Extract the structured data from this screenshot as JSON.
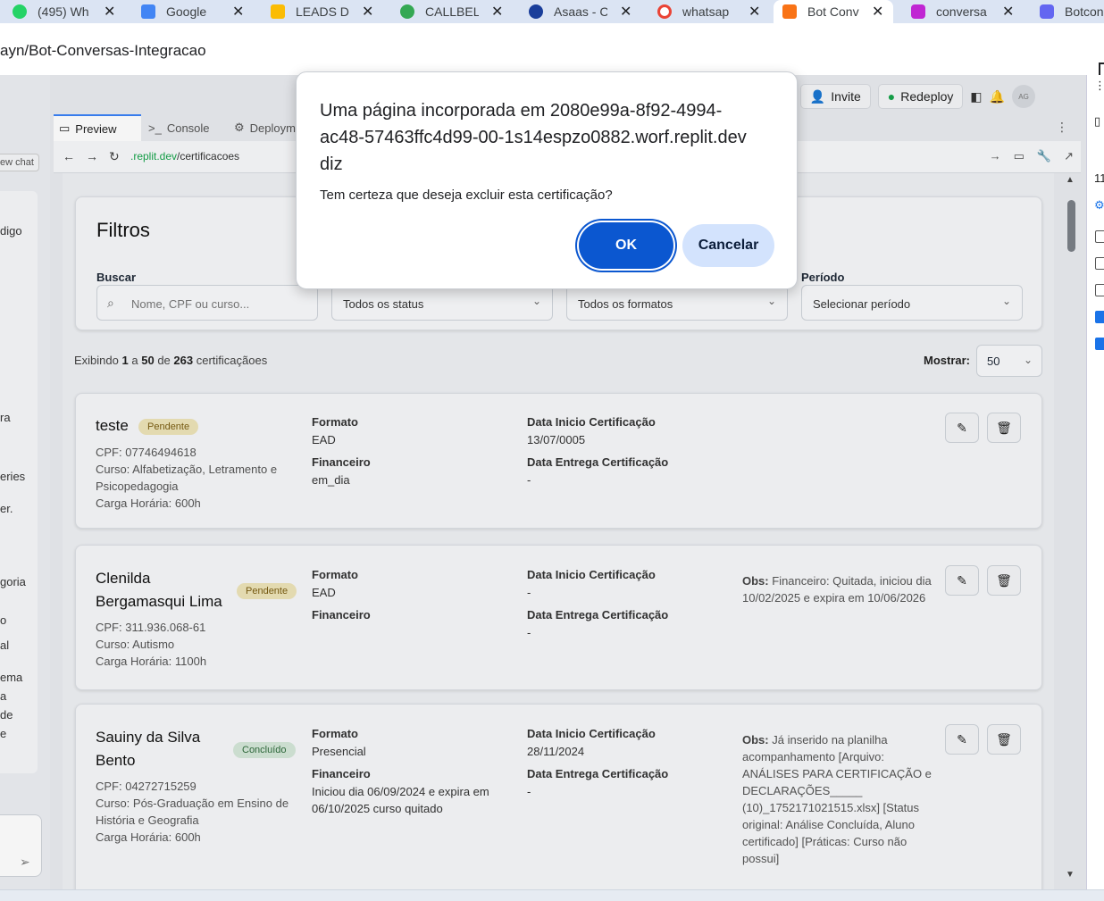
{
  "browser": {
    "tabs": [
      {
        "label": "(495) Wh",
        "color": "#25d366"
      },
      {
        "label": "Google",
        "color": "#4285f4"
      },
      {
        "label": "LEADS D",
        "color": "#fbbc04"
      },
      {
        "label": "CALLBEL",
        "color": "#34a853"
      },
      {
        "label": "Asaas - C",
        "color": "#1a3e9a"
      },
      {
        "label": "whatsap",
        "color": "#ea4335"
      },
      {
        "label": "Bot Conv",
        "color": "#f97316",
        "active": true
      },
      {
        "label": "conversa",
        "color": "#c026d3"
      },
      {
        "label": "Botcon",
        "color": "#6366f1"
      }
    ],
    "address": "ayn/Bot-Conversas-Integracao"
  },
  "replit": {
    "new_chat": "ew chat",
    "chat_fragments": [
      "digo",
      "ra",
      "eries",
      "er.",
      "goria",
      "o",
      "al",
      "ema",
      "a",
      "de",
      "e"
    ],
    "invite": "Invite",
    "redeploy": "Redeploy",
    "avatar": "AG",
    "pane_tabs": [
      "Preview",
      "Console",
      "Deploym"
    ],
    "url_link": ".replit.dev",
    "url_path": "/certificacoes"
  },
  "filters": {
    "title": "Filtros",
    "search_label": "Buscar",
    "search_placeholder": "Nome, CPF ou curso...",
    "status_value": "Todos os status",
    "format_value": "Todos os formatos",
    "period_label": "Período",
    "period_value": "Selecionar período"
  },
  "summary": {
    "prefix": "Exibindo",
    "from": "1",
    "a": "a",
    "to": "50",
    "de": "de",
    "total": "263",
    "suffix": "certificaçãoes",
    "show_label": "Mostrar:",
    "show_value": "50"
  },
  "field_labels": {
    "formato": "Formato",
    "financeiro": "Financeiro",
    "inicio": "Data Inicio Certificação",
    "entrega": "Data Entrega Certificação",
    "obs": "Obs:"
  },
  "records": [
    {
      "name": "teste",
      "status": "Pendente",
      "cpf": "CPF: 07746494618",
      "curso": "Curso: Alfabetização, Letramento e Psicopedagogia",
      "carga": "Carga Horária: 600h",
      "formato": "EAD",
      "financeiro": "em_dia",
      "inicio": "13/07/0005",
      "entrega": "-",
      "obs": ""
    },
    {
      "name": "Clenilda Bergamasqui Lima",
      "status": "Pendente",
      "cpf": "CPF: 311.936.068-61",
      "curso": "Curso: Autismo",
      "carga": "Carga Horária: 1100h",
      "formato": "EAD",
      "financeiro": "",
      "inicio": "-",
      "entrega": "-",
      "obs": "Financeiro: Quitada, iniciou dia 10/02/2025 e expira em 10/06/2026"
    },
    {
      "name": "Sauiny da Silva Bento",
      "status": "Concluído",
      "cpf": "CPF: 04272715259",
      "curso": "Curso: Pós-Graduação em Ensino de História e Geografia",
      "carga": "Carga Horária: 600h",
      "formato": "Presencial",
      "financeiro": "Iniciou dia 06/09/2024 e expira em 06/10/2025 curso quitado",
      "inicio": "28/11/2024",
      "entrega": "-",
      "obs": "Já inserido na planilha acompanhamento [Arquivo: ANÁLISES PARA CERTIFICAÇÃO e DECLARAÇÕES_____ (10)_1752171021515.xlsx] [Status original: Análise Concluída, Aluno certificado] [Práticas: Curso não possui]"
    }
  ],
  "devtools": {
    "number": "11"
  },
  "dialog": {
    "title": "Uma página incorporada em 2080e99a-8f92-4994-ac48-57463ffc4d99-00-1s14espzo0882.worf.replit.dev diz",
    "message": "Tem certeza que deseja excluir esta certificação?",
    "ok": "OK",
    "cancel": "Cancelar"
  }
}
